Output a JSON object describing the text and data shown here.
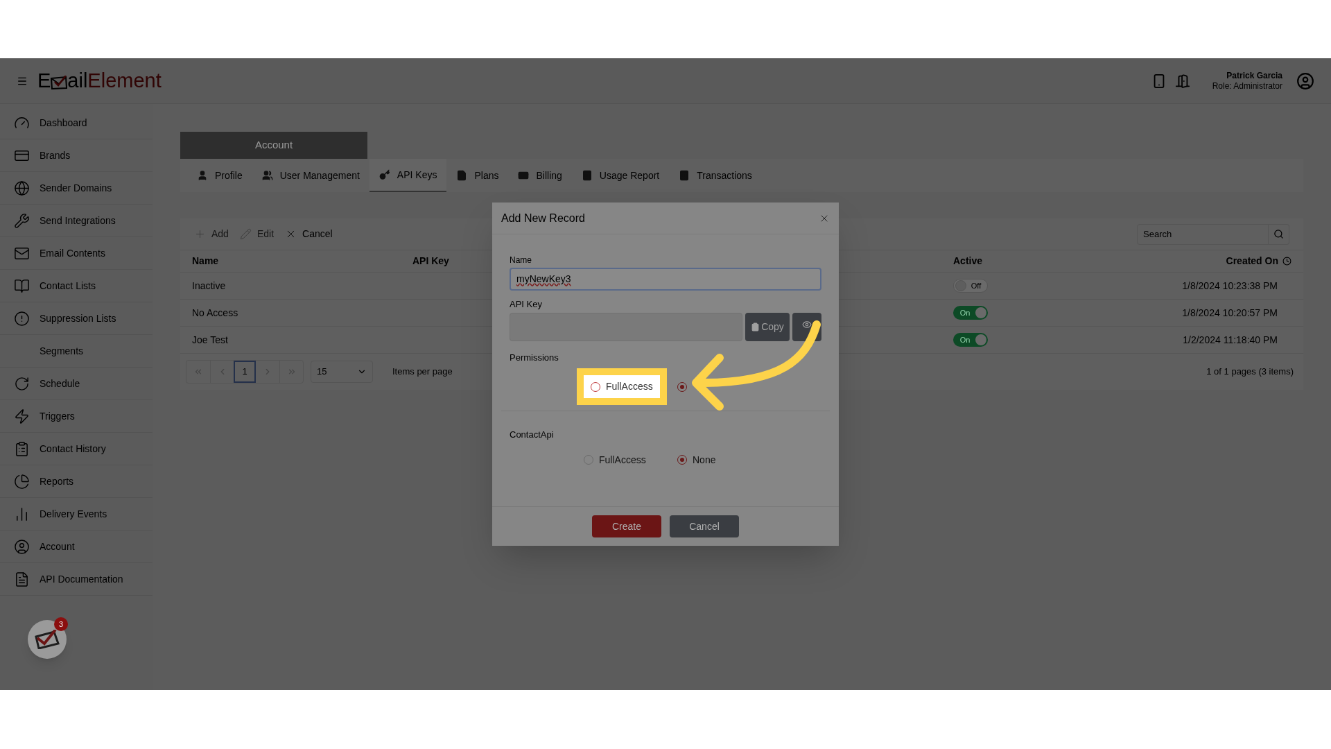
{
  "header": {
    "logo": {
      "first": "E",
      "middle": "ail",
      "last": "Element"
    },
    "user": {
      "name": "Patrick Garcia",
      "role": "Role: Administrator"
    }
  },
  "sidebar": {
    "items": [
      {
        "label": "Dashboard"
      },
      {
        "label": "Brands"
      },
      {
        "label": "Sender Domains"
      },
      {
        "label": "Send Integrations"
      },
      {
        "label": "Email Contents"
      },
      {
        "label": "Contact Lists"
      },
      {
        "label": "Suppression Lists"
      },
      {
        "label": "Segments"
      },
      {
        "label": "Schedule"
      },
      {
        "label": "Triggers"
      },
      {
        "label": "Contact History"
      },
      {
        "label": "Reports"
      },
      {
        "label": "Delivery Events"
      },
      {
        "label": "Account"
      },
      {
        "label": "API Documentation"
      }
    ],
    "badge": "3"
  },
  "section_title": "Account",
  "tabs": [
    {
      "label": "Profile",
      "selected": false
    },
    {
      "label": "User Management",
      "selected": false
    },
    {
      "label": "API Keys",
      "selected": true
    },
    {
      "label": "Plans",
      "selected": false
    },
    {
      "label": "Billing",
      "selected": false
    },
    {
      "label": "Usage Report",
      "selected": false
    },
    {
      "label": "Transactions",
      "selected": false
    }
  ],
  "toolbar": [
    {
      "label": "Add",
      "disabled": true
    },
    {
      "label": "Edit",
      "disabled": true
    },
    {
      "label": "Cancel",
      "disabled": false
    }
  ],
  "search": {
    "placeholder": "Search"
  },
  "table": {
    "columns": [
      "Name",
      "API Key",
      "Active",
      "Created On"
    ],
    "rows": [
      {
        "name": "Inactive",
        "active": false,
        "active_label": "Off",
        "created": "1/8/2024 10:23:38 PM"
      },
      {
        "name": "No Access",
        "active": true,
        "active_label": "On",
        "created": "1/8/2024 10:20:57 PM"
      },
      {
        "name": "Joe Test",
        "active": true,
        "active_label": "On",
        "created": "1/2/2024 11:18:40 PM"
      }
    ]
  },
  "pager": {
    "pages": [
      {
        "label": "1",
        "selected": true
      }
    ],
    "page_size": "15",
    "page_size_label": "Items per page",
    "info": "1 of 1 pages (3 items)"
  },
  "dialog": {
    "title": "Add New Record",
    "name_label": "Name",
    "name_value": "myNewKey3",
    "api_key_label": "API Key",
    "copy_label": "Copy",
    "groups": [
      {
        "label": "Permissions",
        "options": [
          {
            "label": "FullAccess",
            "selected": false,
            "highlighted": true
          },
          {
            "selected": true,
            "highlighted": false
          }
        ]
      },
      {
        "label": "ContactApi",
        "options": [
          {
            "label": "FullAccess",
            "selected": false,
            "highlighted": false
          },
          {
            "label": "None",
            "selected": true,
            "highlighted": false
          }
        ]
      }
    ],
    "buttons": [
      {
        "label": "Create",
        "kind": "primary"
      },
      {
        "label": "Cancel",
        "kind": "secondary"
      }
    ]
  }
}
